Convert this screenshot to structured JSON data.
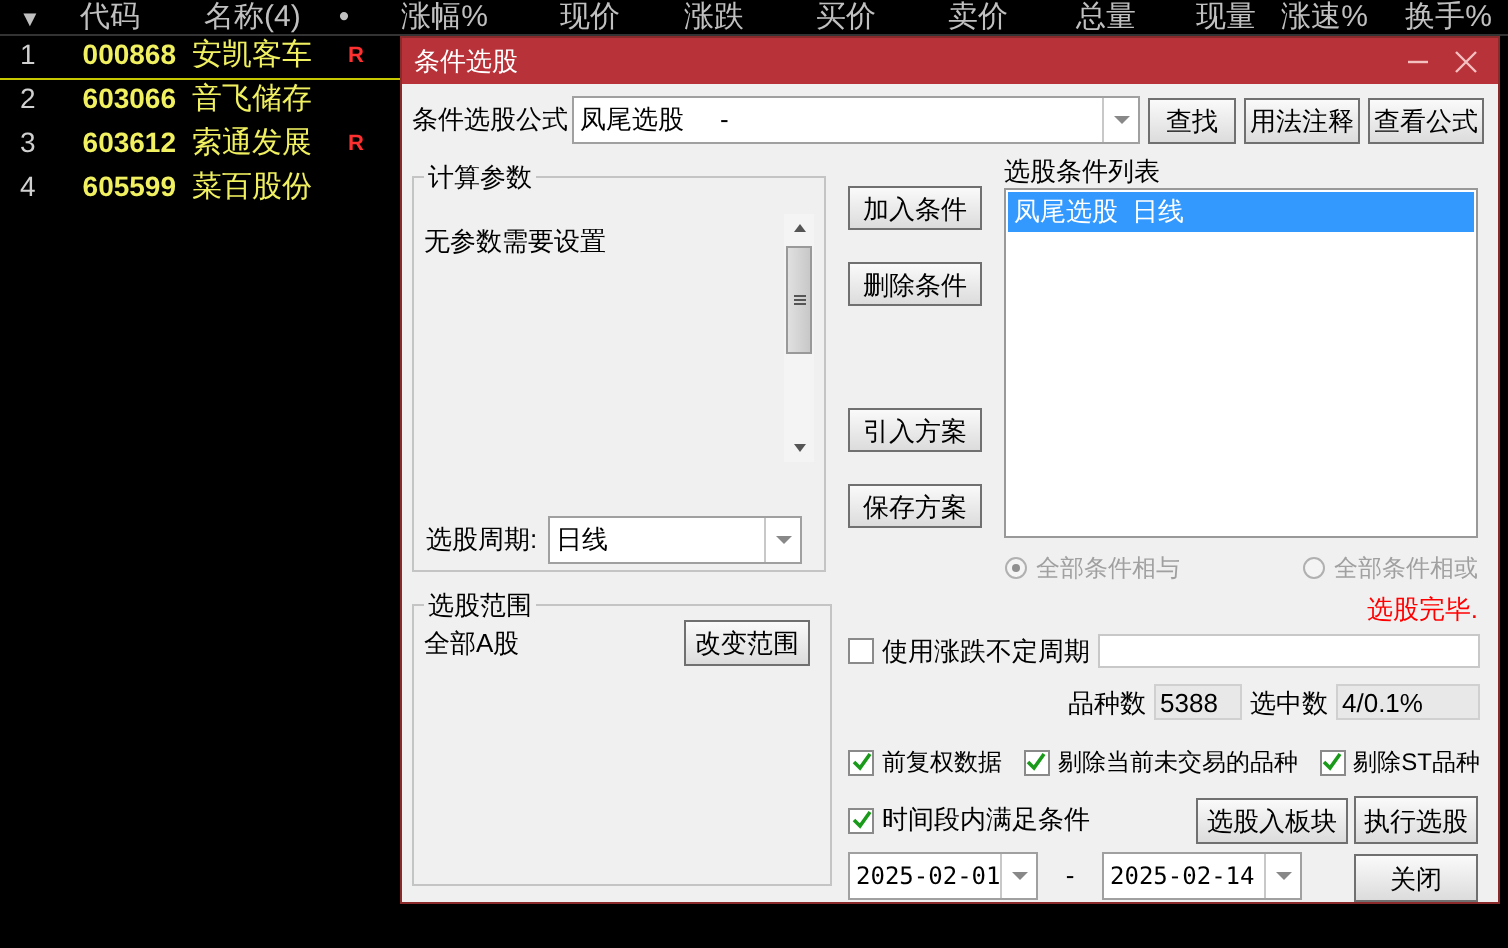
{
  "table": {
    "columns": [
      "▼",
      "代码",
      "名称(4)",
      "•",
      "涨幅%",
      "现价",
      "涨跌",
      "买价",
      "卖价",
      "总量",
      "现量",
      "涨速%",
      "换手%"
    ],
    "rows": [
      {
        "index": "1",
        "code": "000868",
        "name": "安凯客车",
        "flag": "R",
        "selected": true
      },
      {
        "index": "2",
        "code": "603066",
        "name": "音飞储存",
        "selected": false
      },
      {
        "index": "3",
        "code": "603612",
        "name": "索通发展",
        "flag": "R",
        "selected": false
      },
      {
        "index": "4",
        "code": "605599",
        "name": "菜百股份",
        "selected": false
      }
    ]
  },
  "dialog": {
    "title": "条件选股",
    "formula": {
      "label": "条件选股公式",
      "value": "凤尾选股     -"
    },
    "top_buttons": [
      "查找",
      "用法注释",
      "查看公式"
    ],
    "params": {
      "title": "计算参数",
      "message": "无参数需要设置",
      "period_label": "选股周期:",
      "period_value": "日线"
    },
    "side_buttons": [
      "加入条件",
      "删除条件",
      "引入方案",
      "保存方案"
    ],
    "condition_list": {
      "label": "选股条件列表",
      "items": [
        {
          "text": "凤尾选股  日线",
          "selected": true
        }
      ]
    },
    "radios": [
      {
        "label": "全部条件相与",
        "selected": true,
        "disabled": true
      },
      {
        "label": "全部条件相或",
        "selected": false,
        "disabled": true
      }
    ],
    "status": "选股完毕.",
    "scope": {
      "title": "选股范围",
      "value": "全部A股",
      "button": "改变范围"
    },
    "variable_period": {
      "label": "使用涨跌不定周期",
      "checked": false
    },
    "counts": [
      {
        "label": "品种数",
        "value": "5388"
      },
      {
        "label": "选中数",
        "value": "4/0.1%"
      }
    ],
    "options": [
      {
        "label": "前复权数据",
        "checked": true
      },
      {
        "label": "剔除当前未交易的品种",
        "checked": true
      },
      {
        "label": "剔除ST品种",
        "checked": true
      }
    ],
    "time_condition": {
      "label": "时间段内满足条件",
      "checked": true
    },
    "date_from": "2025-02-01",
    "date_separator": "-",
    "date_to": "2025-02-14",
    "action_buttons": [
      "选股入板块",
      "执行选股",
      "关闭"
    ]
  }
}
